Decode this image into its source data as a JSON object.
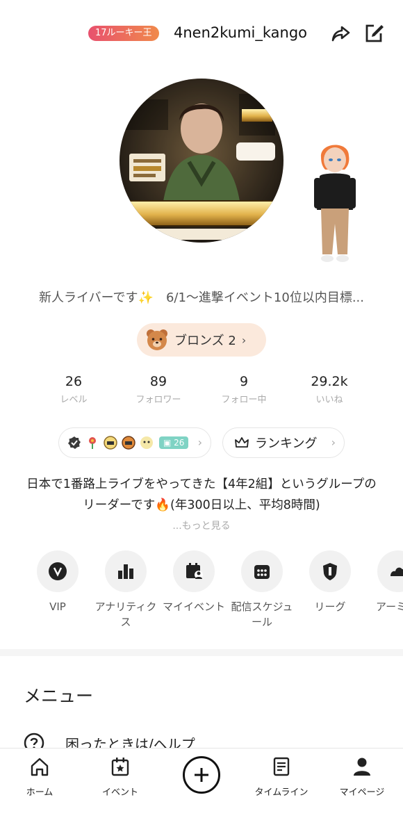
{
  "header": {
    "rookie_badge": "17ルーキー王",
    "username": "4nen2kumi_kango"
  },
  "bio_line": "新人ライバーです✨　6/1～進撃イベント10位以内目標...",
  "rank": {
    "label": "ブロンズ 2"
  },
  "stats": [
    {
      "value": "26",
      "label": "レベル"
    },
    {
      "value": "89",
      "label": "フォロワー"
    },
    {
      "value": "9",
      "label": "フォロー中"
    },
    {
      "value": "29.2k",
      "label": "いいね"
    }
  ],
  "badges": {
    "count": "26"
  },
  "ranking": {
    "label": "ランキング"
  },
  "description": "日本で1番路上ライブをやってきた【4年2組】というグループのリーダーです🔥(年300日以上、平均8時間)",
  "more_label": "...もっと見る",
  "shortcuts": [
    {
      "label": "VIP",
      "icon": "vip-icon"
    },
    {
      "label": "アナリティクス",
      "icon": "analytics-icon"
    },
    {
      "label": "マイイベント",
      "icon": "my-event-icon"
    },
    {
      "label": "配信スケジュール",
      "icon": "schedule-icon"
    },
    {
      "label": "リーグ",
      "icon": "league-icon"
    },
    {
      "label": "アーミ",
      "icon": "army-icon"
    }
  ],
  "menu": {
    "title": "メニュー",
    "items": [
      {
        "label": "困ったときは/ヘルプ",
        "icon": "help-icon"
      }
    ]
  },
  "tabbar": [
    {
      "label": "ホーム",
      "icon": "home-icon"
    },
    {
      "label": "イベント",
      "icon": "event-icon"
    },
    {
      "label": "",
      "icon": "plus-icon"
    },
    {
      "label": "タイムライン",
      "icon": "timeline-icon"
    },
    {
      "label": "マイページ",
      "icon": "profile-icon"
    }
  ],
  "colors": {
    "accent_gradient_start": "#e8516e",
    "accent_gradient_end": "#f08a4b",
    "rank_pill_bg": "#fbe9dc"
  }
}
